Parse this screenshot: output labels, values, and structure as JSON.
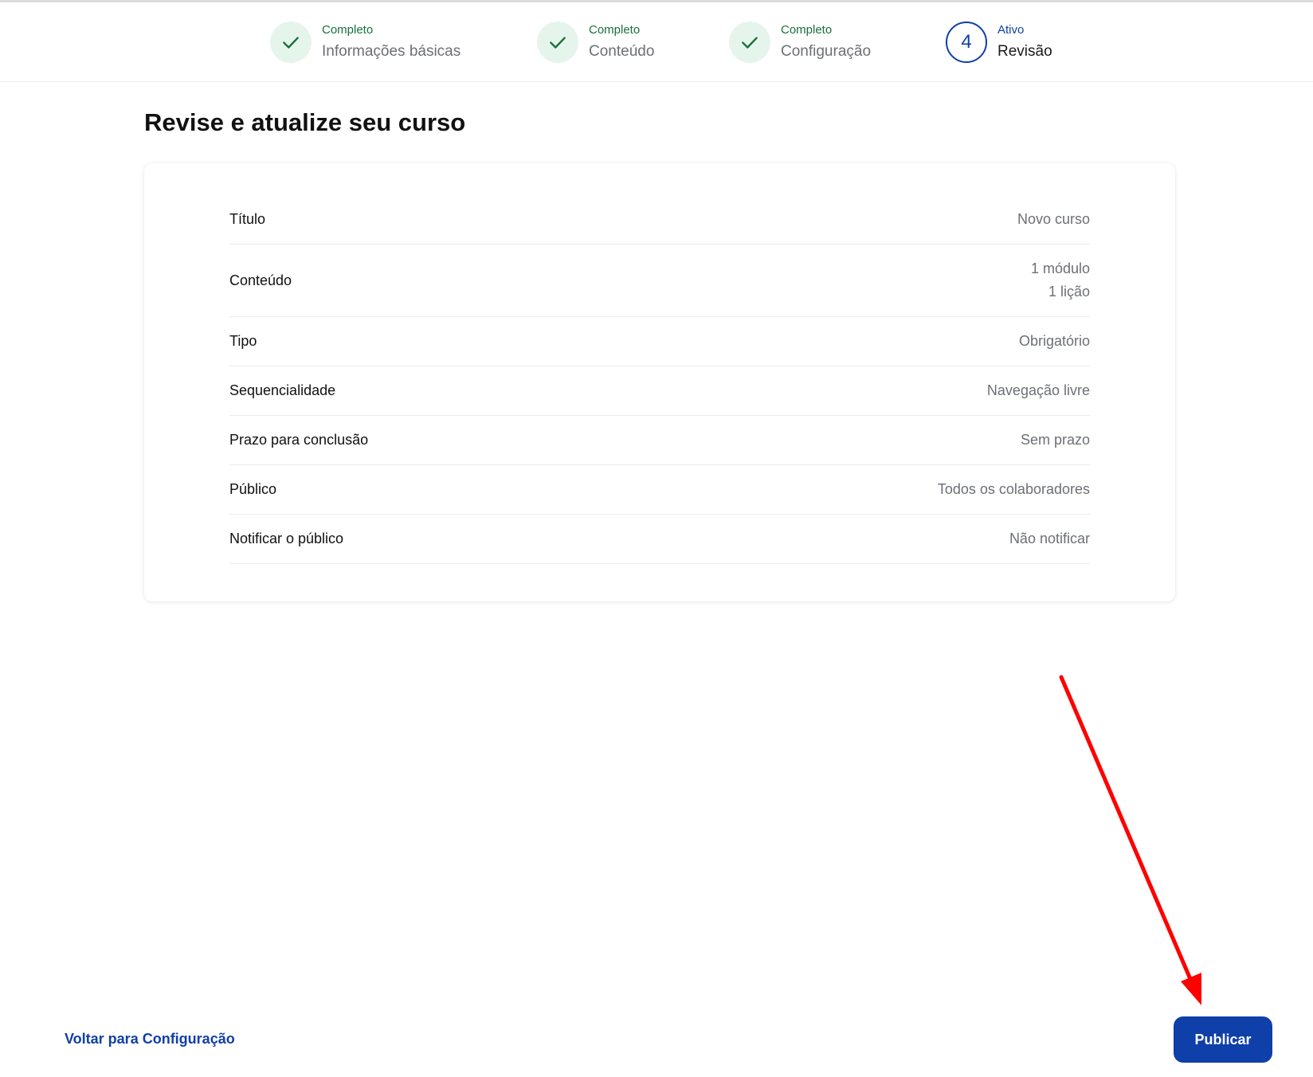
{
  "stepper": {
    "steps": [
      {
        "status": "Completo",
        "label": "Informações básicas",
        "icon": "check-icon"
      },
      {
        "status": "Completo",
        "label": "Conteúdo",
        "icon": "check-icon"
      },
      {
        "status": "Completo",
        "label": "Configuração",
        "icon": "check-icon"
      },
      {
        "status": "Ativo",
        "label": "Revisão",
        "number": "4"
      }
    ]
  },
  "page": {
    "title": "Revise e atualize seu curso"
  },
  "summary": {
    "rows": [
      {
        "key": "Título",
        "value": "Novo curso"
      },
      {
        "key": "Conteúdo",
        "values": [
          "1 módulo",
          "1 lição"
        ]
      },
      {
        "key": "Tipo",
        "value": "Obrigatório"
      },
      {
        "key": "Sequencialidade",
        "value": "Navegação livre"
      },
      {
        "key": "Prazo para conclusão",
        "value": "Sem prazo"
      },
      {
        "key": "Público",
        "value": "Todos os colaboradores"
      },
      {
        "key": "Notificar o público",
        "value": "Não notificar"
      }
    ]
  },
  "footer": {
    "back_label": "Voltar para Configuração",
    "publish_label": "Publicar"
  },
  "colors": {
    "primary": "#0f3fa8",
    "complete_green": "#17713b",
    "complete_bg": "#e6f5ec",
    "annotation_red": "#ff0000"
  }
}
